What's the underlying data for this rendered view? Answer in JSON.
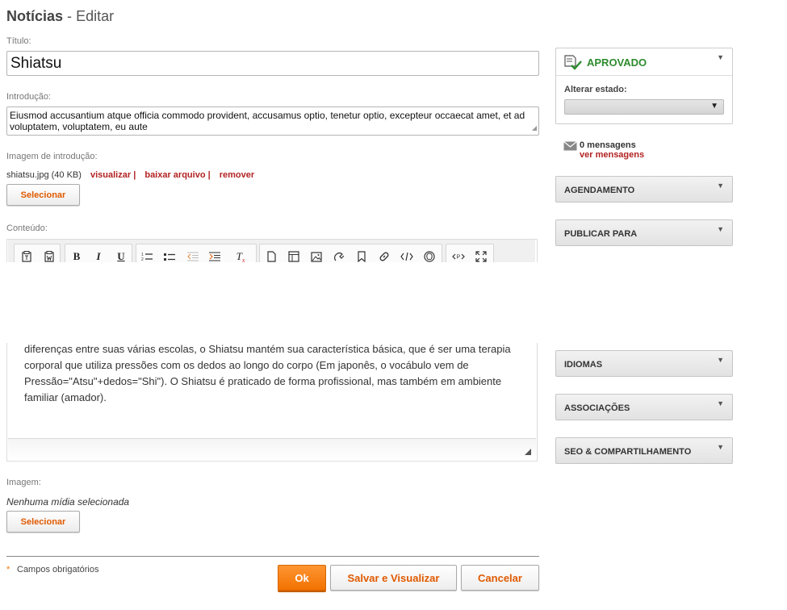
{
  "page": {
    "title_main": "Notícias",
    "title_sep": "-",
    "title_action": "Editar"
  },
  "form": {
    "title_label": "Título:",
    "title_value": "Shiatsu",
    "intro_label": "Introdução:",
    "intro_value": "Eiusmod accusantium atque officia commodo provident, accusamus optio, tenetur optio, excepteur occaecat amet, et ad voluptatem, voluptatem, eu aute",
    "intro_image_label": "Imagem de introdução:",
    "intro_image_file": "shiatsu.jpg (40 KB)",
    "link_view": "visualizar |",
    "link_download": "baixar arquivo |",
    "link_remove": "remover",
    "select_label": "Selecionar",
    "content_label": "Conteúdo:",
    "content_text": "diferenças entre suas várias escolas, o Shiatsu mantém sua característica básica, que é ser uma terapia corporal que utiliza pressões com os dedos ao longo do corpo (Em japonês, o vocábulo vem de Pressão=\"Atsu\"+dedos=\"Shi\"). O Shiatsu é praticado de forma profissional, mas também em ambiente familiar (amador).",
    "image_label": "Imagem:",
    "image_empty": "Nenhuma mídia selecionada",
    "required_mark": "*",
    "required_text": "Campos obrigatórios"
  },
  "toolbar": {
    "bold": "B",
    "italic": "I",
    "underline": "U",
    "clear_format": "T"
  },
  "buttons": {
    "ok": "Ok",
    "save_view": "Salvar e Visualizar",
    "cancel": "Cancelar"
  },
  "sidebar": {
    "status": "APROVADO",
    "change_state_label": "Alterar estado:",
    "messages_count": "0 mensagens",
    "messages_link": "ver mensagens",
    "sections": {
      "scheduling": "AGENDAMENTO",
      "publish_to": "PUBLICAR PARA",
      "languages": "IDIOMAS",
      "associations": "ASSOCIAÇÕES",
      "seo": "SEO & COMPARTILHAMENTO"
    }
  },
  "colors": {
    "accent": "#f27200",
    "approved": "#2e8b2e",
    "link": "#b22222"
  },
  "icons": [
    "approved-doc-icon",
    "envelope-icon",
    "chevron-down-icon",
    "resize-grip-icon"
  ]
}
